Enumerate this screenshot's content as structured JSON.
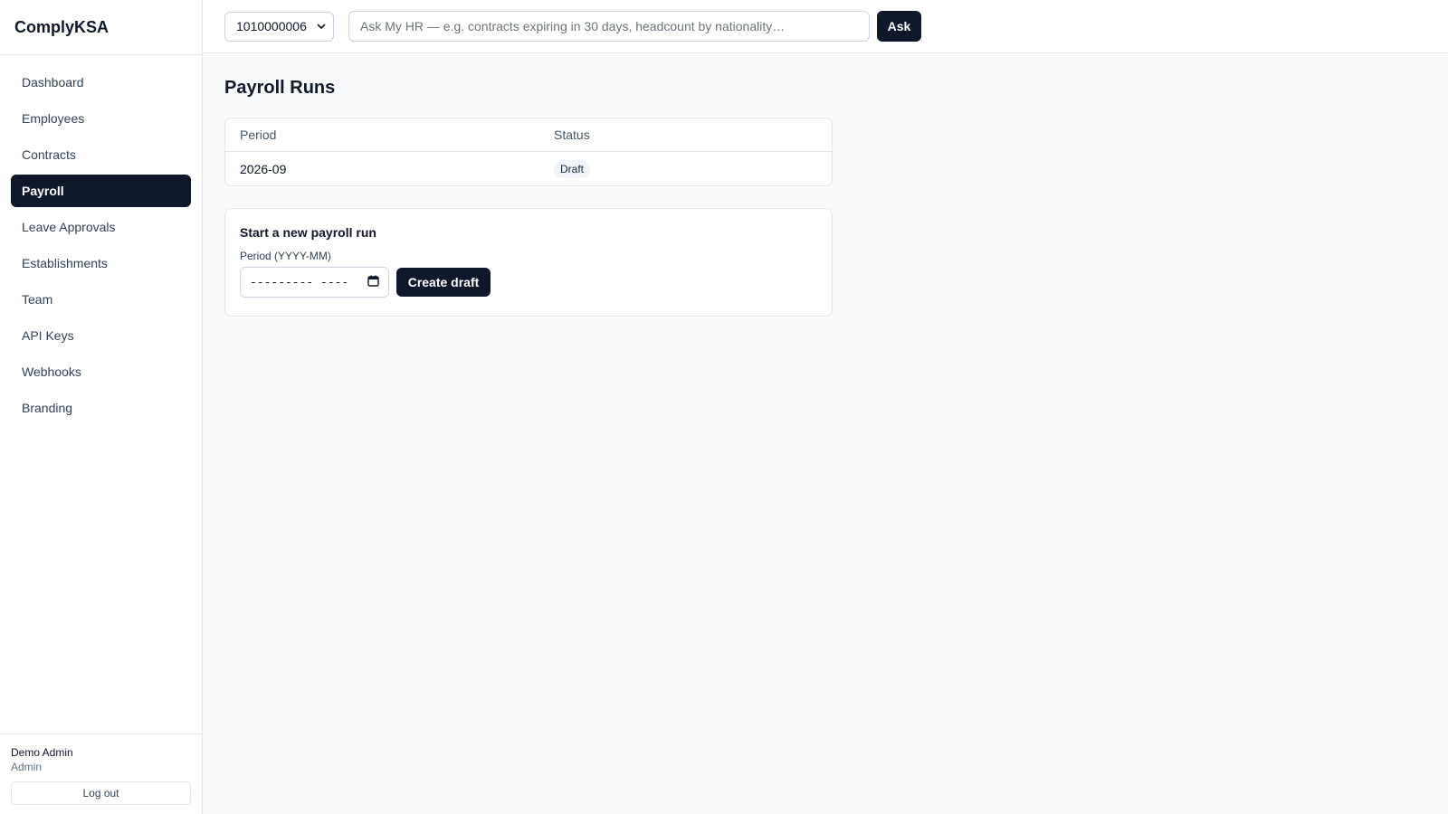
{
  "app": {
    "brand": "ComplyKSA"
  },
  "sidebar": {
    "items": [
      {
        "label": "Dashboard"
      },
      {
        "label": "Employees"
      },
      {
        "label": "Contracts"
      },
      {
        "label": "Payroll"
      },
      {
        "label": "Leave Approvals"
      },
      {
        "label": "Establishments"
      },
      {
        "label": "Team"
      },
      {
        "label": "API Keys"
      },
      {
        "label": "Webhooks"
      },
      {
        "label": "Branding"
      }
    ],
    "active_index": 3,
    "user": {
      "name": "Demo Admin",
      "role": "Admin",
      "logout_label": "Log out"
    }
  },
  "topbar": {
    "establishment_value": "1010000006",
    "ask_placeholder": "Ask My HR — e.g. contracts expiring in 30 days, headcount by nationality…",
    "ask_label": "Ask"
  },
  "main": {
    "title": "Payroll Runs",
    "table": {
      "headers": [
        "Period",
        "Status"
      ],
      "rows": [
        {
          "period": "2026-09",
          "status": "Draft"
        }
      ]
    },
    "new_run": {
      "title": "Start a new payroll run",
      "period_label": "Period (YYYY-MM)",
      "period_value": "--------- ----",
      "create_label": "Create draft"
    }
  }
}
